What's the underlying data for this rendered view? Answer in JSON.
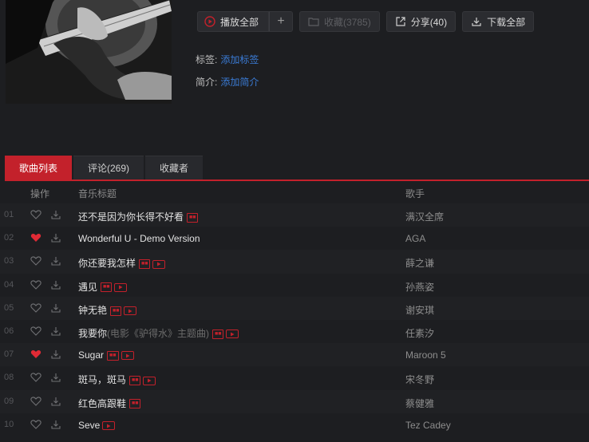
{
  "actions": {
    "play_all": "播放全部",
    "add": "+",
    "collect": "收藏(3785)",
    "share": "分享(40)",
    "download_all": "下载全部"
  },
  "meta": {
    "tags_label": "标签:",
    "tags_link": "添加标签",
    "intro_label": "简介:",
    "intro_link": "添加简介"
  },
  "tabs": [
    {
      "label": "歌曲列表",
      "active": true
    },
    {
      "label": "评论(269)",
      "active": false
    },
    {
      "label": "收藏者",
      "active": false
    }
  ],
  "table": {
    "headers": {
      "ops": "操作",
      "title": "音乐标题",
      "artist": "歌手"
    },
    "rows": [
      {
        "num": "01",
        "liked": false,
        "title": "还不是因为你长得不好看",
        "sub": "",
        "sq": true,
        "mv": false,
        "artist": "满汉全席"
      },
      {
        "num": "02",
        "liked": true,
        "title": "Wonderful U - Demo Version",
        "sub": "",
        "sq": false,
        "mv": false,
        "artist": "AGA"
      },
      {
        "num": "03",
        "liked": false,
        "title": "你还要我怎样",
        "sub": "",
        "sq": true,
        "mv": true,
        "artist": "薛之谦"
      },
      {
        "num": "04",
        "liked": false,
        "title": "遇见",
        "sub": "",
        "sq": true,
        "mv": true,
        "artist": "孙燕姿"
      },
      {
        "num": "05",
        "liked": false,
        "title": "钟无艳",
        "sub": "",
        "sq": true,
        "mv": true,
        "artist": "谢安琪"
      },
      {
        "num": "06",
        "liked": false,
        "title": "我要你",
        "sub": "(电影《驴得水》主题曲)",
        "sq": true,
        "mv": true,
        "artist": "任素汐"
      },
      {
        "num": "07",
        "liked": true,
        "title": "Sugar",
        "sub": "",
        "sq": true,
        "mv": true,
        "artist": "Maroon 5"
      },
      {
        "num": "08",
        "liked": false,
        "title": "斑马，斑马",
        "sub": "",
        "sq": true,
        "mv": true,
        "artist": "宋冬野"
      },
      {
        "num": "09",
        "liked": false,
        "title": "红色高跟鞋",
        "sub": "",
        "sq": true,
        "mv": false,
        "artist": "蔡健雅"
      },
      {
        "num": "10",
        "liked": false,
        "title": "Seve",
        "sub": "",
        "sq": false,
        "mv": true,
        "artist": "Tez Cadey"
      }
    ]
  },
  "icons": {
    "play": "play-circle-icon",
    "collect": "folder-plus-icon",
    "share": "share-icon",
    "download": "download-icon",
    "heart": "heart-icon",
    "mv": "mv-play-icon"
  },
  "colors": {
    "accent": "#c3212b",
    "link": "#3a7bd5",
    "background": "#1d1e21"
  }
}
